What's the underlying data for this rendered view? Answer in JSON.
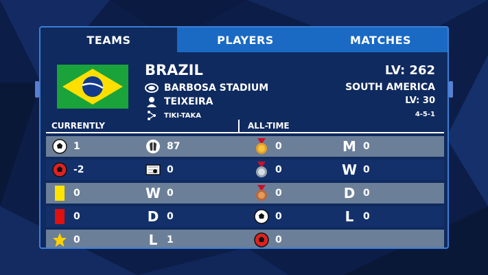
{
  "tabs": [
    {
      "label": "TEAMS",
      "active": true
    },
    {
      "label": "PLAYERS",
      "active": false
    },
    {
      "label": "MATCHES",
      "active": false
    }
  ],
  "team": {
    "name": "BRAZIL",
    "stadium": "BARBOSA STADIUM",
    "coach": "TEIXEIRA",
    "tactic": "TIKI-TAKA",
    "level": "LV: 262",
    "region": "SOUTH AMERICA",
    "coach_level": "LV: 30",
    "formation": "4-5-1"
  },
  "sections": {
    "currently": "CURRENTLY",
    "all_time": "ALL-TIME"
  },
  "rows": [
    {
      "c1_icon": "ball-icon",
      "c1": "1",
      "c2_icon": "jersey-icon",
      "c2": "87",
      "c3_icon": "gold-medal-icon",
      "c3": "0",
      "c4_letter": "M",
      "c4": "0"
    },
    {
      "c1_icon": "red-ball-icon",
      "c1": "-2",
      "c2_icon": "goal-icon",
      "c2": "0",
      "c3_icon": "silver-medal-icon",
      "c3": "0",
      "c4_letter": "W",
      "c4": "0"
    },
    {
      "c1_icon": "yellow-card-icon",
      "c1": "0",
      "c2_letter": "W",
      "c2": "0",
      "c3_icon": "bronze-medal-icon",
      "c3": "0",
      "c4_letter": "D",
      "c4": "0"
    },
    {
      "c1_icon": "red-card-icon",
      "c1": "0",
      "c2_letter": "D",
      "c2": "0",
      "c3_icon": "ball-icon",
      "c3": "0",
      "c4_letter": "L",
      "c4": "0"
    },
    {
      "c1_icon": "star-icon",
      "c1": "0",
      "c2_letter": "L",
      "c2": "1",
      "c3_icon": "red-ball-icon",
      "c3": "0"
    }
  ],
  "colors": {
    "panel": "#0f2a5e",
    "tab_bar": "#1a6ac4",
    "row_light": "#6b7f99",
    "row_dark": "#13306b",
    "border": "#3d7fd6"
  }
}
